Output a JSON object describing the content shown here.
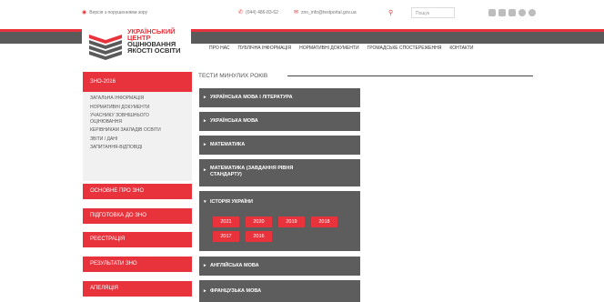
{
  "topbar": {
    "version_label": "Версія з порушеннями зору",
    "phone": "(044) 486-83-62",
    "email": "zno_info@testportal.gov.ua",
    "search_placeholder": "Пошук",
    "social_icons": [
      "rss-icon",
      "vk-icon",
      "facebook-icon",
      "twitter-icon",
      "youtube-icon"
    ]
  },
  "logo": {
    "line1": "УКРАЇНСЬКИЙ",
    "line2": "ЦЕНТР",
    "line3": "ОЦІНЮВАННЯ",
    "line4": "ЯКОСТІ ОСВІТИ"
  },
  "nav": [
    "ПРО НАС",
    "ПУБЛІЧНА ІНФОРМАЦІЯ",
    "НОРМАТИВНІ ДОКУМЕНТИ",
    "ГРОМАДСЬКЕ СПОСТЕРЕЖЕННЯ",
    "КОНТАКТИ"
  ],
  "sidebar": {
    "active": "ЗНО-2016",
    "submenu": [
      "ЗАГАЛЬНА ІНФОРМАЦІЯ",
      "НОРМАТИВНІ ДОКУМЕНТИ",
      "УЧАСНИКУ ЗОВНІШНЬОГО ОЦІНЮВАННЯ",
      "КЕРІВНИКАМ ЗАКЛАДІВ ОСВІТИ",
      "ЗВІТИ / ДАНІ",
      "ЗАПИТАННЯ-ВІДПОВІДІ"
    ],
    "buttons": [
      "ОСНОВНЕ ПРО ЗНО",
      "ПІДГОТОВКА ДО ЗНО",
      "РЕЄСТРАЦІЯ",
      "РЕЗУЛЬТАТИ ЗНО",
      "АПЕЛЯЦІЯ"
    ]
  },
  "main": {
    "title": "ТЕСТИ МИНУЛИХ РОКІВ",
    "accordion": [
      {
        "label": "УКРАЇНСЬКА МОВА І ЛІТЕРАТУРА",
        "expanded": false
      },
      {
        "label": "УКРАЇНСЬКА МОВА",
        "expanded": false
      },
      {
        "label": "МАТЕМАТИКА",
        "expanded": false
      },
      {
        "label": "МАТЕМАТИКА (ЗАВДАННЯ РІВНЯ СТАНДАРТУ)",
        "expanded": false
      },
      {
        "label": "ІСТОРІЯ УКРАЇНИ",
        "expanded": true
      },
      {
        "label": "АНГЛІЙСЬКА МОВА",
        "expanded": false
      },
      {
        "label": "ФРАНЦУЗЬКА МОВА",
        "expanded": false
      }
    ],
    "years": [
      "2021",
      "2020",
      "2019",
      "2018",
      "2017",
      "2016"
    ]
  },
  "colors": {
    "accent": "#e8323c",
    "dark": "#5d5d5d",
    "band": "#5a5a5a"
  }
}
